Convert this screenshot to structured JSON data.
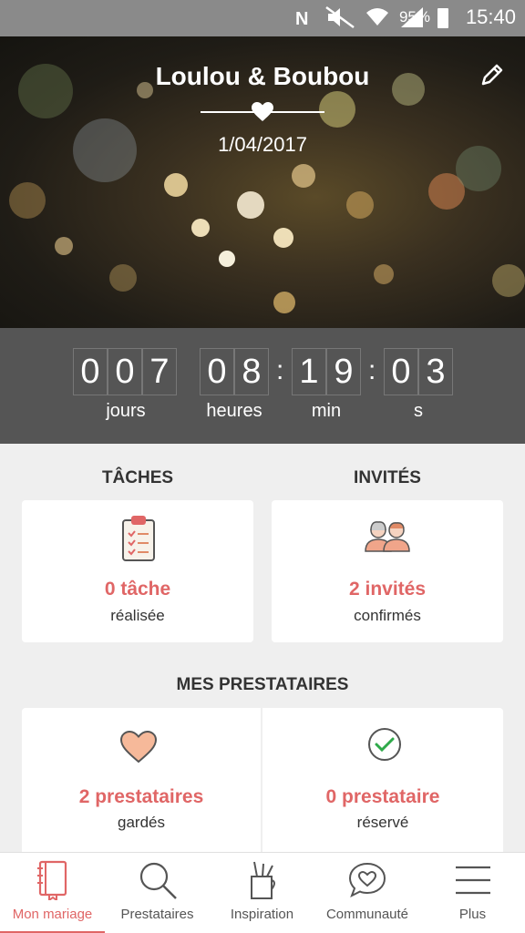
{
  "status_bar": {
    "battery": "95%",
    "time": "15:40",
    "icons": [
      "nfc-icon",
      "mute-icon",
      "wifi-icon",
      "signal-icon",
      "battery-icon"
    ]
  },
  "hero": {
    "couple": "Loulou & Boubou",
    "date": "1/04/2017",
    "edit_icon": "pencil-icon"
  },
  "countdown": {
    "days": [
      "0",
      "0",
      "7"
    ],
    "hours": [
      "0",
      "8"
    ],
    "minutes": [
      "1",
      "9"
    ],
    "seconds": [
      "0",
      "3"
    ],
    "labels": {
      "days": "jours",
      "hours": "heures",
      "minutes": "min",
      "seconds": "s"
    }
  },
  "tasks": {
    "title": "TÂCHES",
    "count": "0 tâche",
    "sub": "réalisée",
    "icon": "clipboard-icon"
  },
  "guests": {
    "title": "INVITÉS",
    "count": "2 invités",
    "sub": "confirmés",
    "icon": "couple-icon"
  },
  "vendors": {
    "title": "MES PRESTATAIRES",
    "saved": {
      "count": "2 prestataires",
      "sub": "gardés",
      "icon": "heart-icon"
    },
    "booked": {
      "count": "0 prestataire",
      "sub": "réservé",
      "icon": "check-circle-icon"
    }
  },
  "nav": {
    "items": [
      {
        "label": "Mon mariage",
        "icon": "notebook-icon",
        "active": true
      },
      {
        "label": "Prestataires",
        "icon": "search-icon"
      },
      {
        "label": "Inspiration",
        "icon": "pencil-cup-icon"
      },
      {
        "label": "Communauté",
        "icon": "chat-heart-icon"
      },
      {
        "label": "Plus",
        "icon": "menu-icon"
      }
    ]
  },
  "colors": {
    "accent": "#e06666",
    "countdown_bg": "#555555",
    "page_bg": "#efefef"
  }
}
